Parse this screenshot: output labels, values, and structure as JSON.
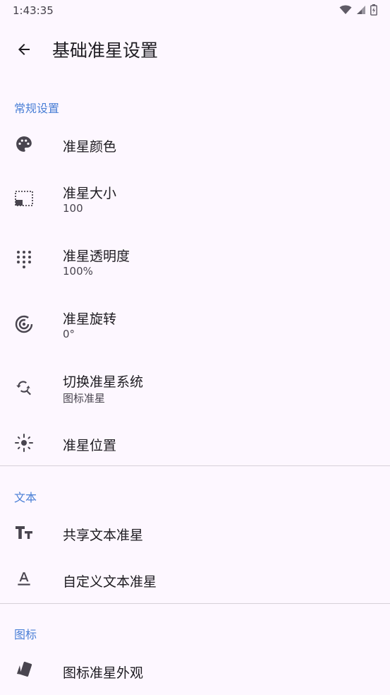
{
  "status_bar": {
    "time": "1:43:35"
  },
  "app_bar": {
    "title": "基础准星设置"
  },
  "sections": {
    "general": {
      "header": "常规设置",
      "items": [
        {
          "title": "准星颜色",
          "icon": "palette-icon"
        },
        {
          "title": "准星大小",
          "summary": "100",
          "icon": "size-icon"
        },
        {
          "title": "准星透明度",
          "summary": "100%",
          "icon": "dots-grid-icon"
        },
        {
          "title": "准星旋转",
          "summary": "0°",
          "icon": "rotation-icon"
        },
        {
          "title": "切换准星系统",
          "summary": "图标准星",
          "icon": "switch-search-icon"
        },
        {
          "title": "准星位置",
          "icon": "crosshair-position-icon"
        }
      ]
    },
    "text": {
      "header": "文本",
      "items": [
        {
          "title": "共享文本准星",
          "icon": "text-size-icon"
        },
        {
          "title": "自定义文本准星",
          "icon": "text-format-icon"
        }
      ]
    },
    "icon": {
      "header": "图标",
      "items": [
        {
          "title": "图标准星外观",
          "icon": "cards-icon"
        }
      ]
    }
  },
  "colors": {
    "accent": "#4a7fd6",
    "background": "#fdf7ff",
    "icon": "#49454f"
  }
}
